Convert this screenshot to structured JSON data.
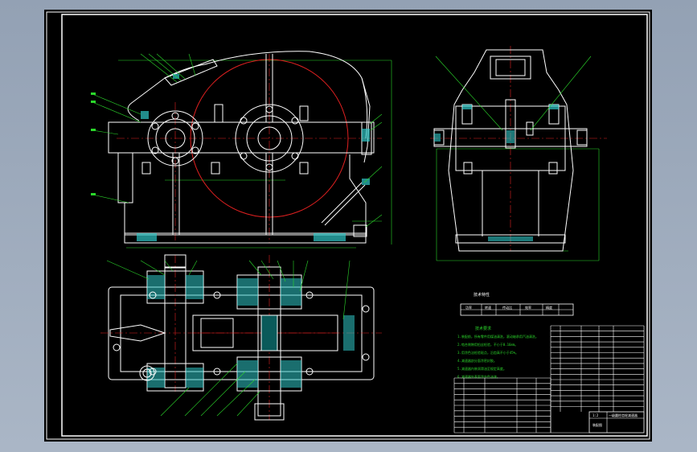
{
  "colors": {
    "background": "#000000",
    "frame": "#ffffff",
    "outline": "#ffffff",
    "centerline": "#e02020",
    "leader": "#2bd82b",
    "section_hatch": "#30c8c8",
    "dimension": "#2bd82b",
    "part_fill": "#0a5a5a"
  },
  "drawing": {
    "tech_table_title": "技术特性",
    "tech_table_headers": [
      "功率",
      "转速",
      "传动比",
      "效率",
      "精度"
    ],
    "notes_title": "技术要求",
    "notes": [
      "1.装配前，所有零件用煤油清洗，滚动轴承用汽油清洗。",
      "2.啮合侧隙用铅丝检验，不小于0.16mm。",
      "3.用涂色法检验斑点，沿齿高不小于45%。",
      "4.减速器剖分面涂密封胶。",
      "5.减速器内装润滑油至规定高度。",
      "6.减速器外表面涂灰色油漆。"
    ],
    "title_block": {
      "name": "一级圆柱齿轮减速器",
      "scale": "1:2",
      "sheet": "装配图"
    }
  }
}
